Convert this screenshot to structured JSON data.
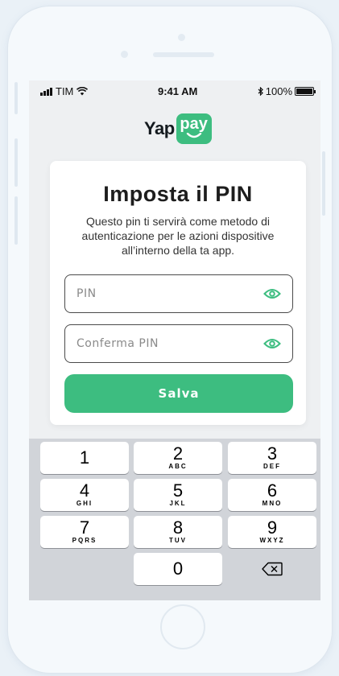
{
  "status_bar": {
    "carrier": "TIM",
    "time": "9:41 AM",
    "battery": "100%"
  },
  "logo": {
    "left": "Yap",
    "right": "pay"
  },
  "card": {
    "title": "Imposta il PIN",
    "description": "Questo pin ti servirà come metodo di autenticazione per le azioni dispositive all’interno della ta app.",
    "pin_placeholder": "PIN",
    "confirm_placeholder": "Conferma PIN",
    "save_label": "Salva"
  },
  "keypad": {
    "keys": [
      {
        "num": "1",
        "letters": ""
      },
      {
        "num": "2",
        "letters": "ABC"
      },
      {
        "num": "3",
        "letters": "DEF"
      },
      {
        "num": "4",
        "letters": "GHI"
      },
      {
        "num": "5",
        "letters": "JKL"
      },
      {
        "num": "6",
        "letters": "MNO"
      },
      {
        "num": "7",
        "letters": "PQRS"
      },
      {
        "num": "8",
        "letters": "TUV"
      },
      {
        "num": "9",
        "letters": "WXYZ"
      },
      {
        "num": "0",
        "letters": ""
      }
    ]
  },
  "colors": {
    "brand": "#3dbd80",
    "background": "#eaf1f7"
  }
}
